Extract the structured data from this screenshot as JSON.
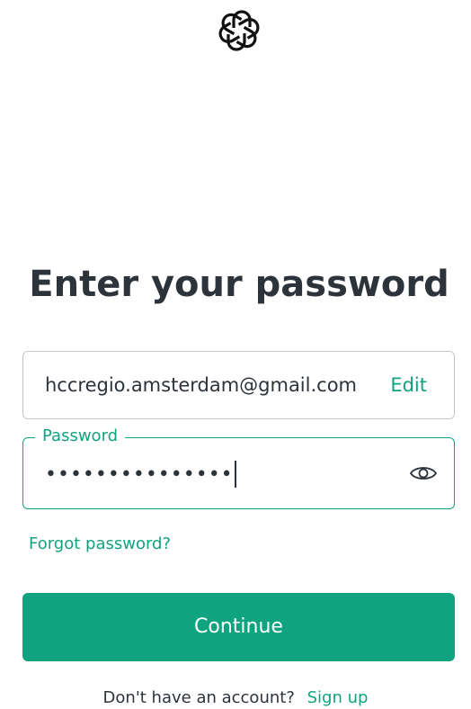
{
  "brand": {
    "logo_icon": "openai-logo-icon",
    "accent_color": "#10a37f"
  },
  "page": {
    "title": "Enter your password"
  },
  "email": {
    "value": "hccregio.amsterdam@gmail.com",
    "edit_label": "Edit"
  },
  "password": {
    "label": "Password",
    "masked_value": "•••••••••••••••",
    "toggle_icon": "eye-icon"
  },
  "links": {
    "forgot_password": "Forgot password?"
  },
  "actions": {
    "continue_label": "Continue"
  },
  "signup": {
    "prompt": "Don't have an account?",
    "link_label": "Sign up"
  }
}
